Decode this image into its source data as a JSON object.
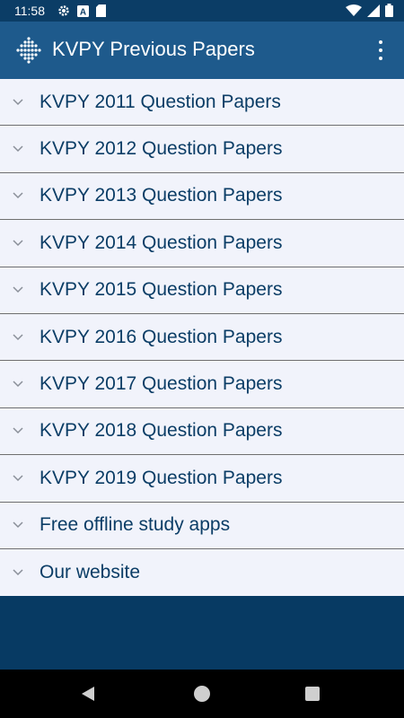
{
  "status_bar": {
    "time": "11:58",
    "left_icons": [
      "gear-icon",
      "a-badge-icon",
      "sd-card-icon"
    ],
    "right_icons": [
      "wifi-icon",
      "signal-icon",
      "battery-icon"
    ]
  },
  "app_bar": {
    "title": "KVPY Previous Papers",
    "logo": "diamond-logo-icon",
    "menu_icon": "overflow-menu-icon"
  },
  "list": {
    "items": [
      {
        "label": "KVPY 2011 Question Papers"
      },
      {
        "label": "KVPY 2012 Question Papers"
      },
      {
        "label": "KVPY 2013 Question Papers"
      },
      {
        "label": "KVPY 2014 Question Papers"
      },
      {
        "label": "KVPY 2015 Question Papers"
      },
      {
        "label": "KVPY 2016 Question Papers"
      },
      {
        "label": "KVPY 2017 Question Papers"
      },
      {
        "label": "KVPY 2018 Question Papers"
      },
      {
        "label": "KVPY 2019 Question Papers"
      },
      {
        "label": "Free offline study apps"
      },
      {
        "label": "Our website"
      }
    ]
  },
  "colors": {
    "app_bar": "#1e5a8c",
    "status_bar": "#0b3d66",
    "background": "#073a63",
    "list_bg": "#f1f3fb",
    "item_text": "#0b3d66"
  }
}
